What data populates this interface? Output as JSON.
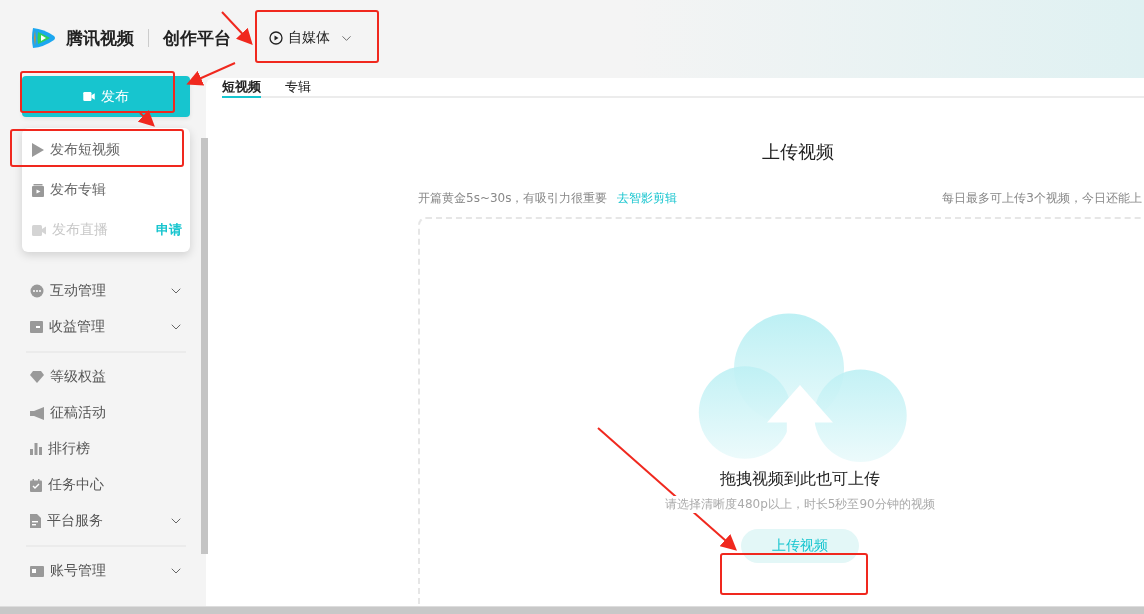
{
  "header": {
    "logo_text": "腾讯视频",
    "platform": "创作平台",
    "account_type": "自媒体"
  },
  "publish_button": "发布",
  "publish_menu": [
    {
      "label": "发布短视频",
      "kind": "play",
      "disabled": false,
      "highlighted": true
    },
    {
      "label": "发布专辑",
      "kind": "album",
      "disabled": false,
      "highlighted": false
    },
    {
      "label": "发布直播",
      "kind": "live",
      "disabled": true,
      "highlighted": false,
      "action": "申请"
    }
  ],
  "sidebar": {
    "groups": [
      [
        {
          "label": "互动管理",
          "kind": "chat",
          "expandable": true
        },
        {
          "label": "收益管理",
          "kind": "wallet",
          "expandable": true
        }
      ],
      [
        {
          "label": "等级权益",
          "kind": "diamond",
          "expandable": false
        },
        {
          "label": "征稿活动",
          "kind": "megaphone",
          "expandable": false
        },
        {
          "label": "排行榜",
          "kind": "bars",
          "expandable": false
        },
        {
          "label": "任务中心",
          "kind": "task",
          "expandable": false
        },
        {
          "label": "平台服务",
          "kind": "doc",
          "expandable": true
        }
      ],
      [
        {
          "label": "账号管理",
          "kind": "card",
          "expandable": true
        }
      ]
    ]
  },
  "tabs": [
    {
      "label": "短视频",
      "selected": true
    },
    {
      "label": "专辑",
      "selected": false
    }
  ],
  "upload": {
    "title": "上传视频",
    "hint": "开篇黄金5s~30s，有吸引力很重要",
    "hint_link": "去智影剪辑",
    "quota": "每日最多可上传3个视频，今日还能上",
    "drop_text": "拖拽视频到此也可上传",
    "requirements": "请选择清晰度480p以上，时长5秒至90分钟的视频",
    "button": "上传视频"
  }
}
